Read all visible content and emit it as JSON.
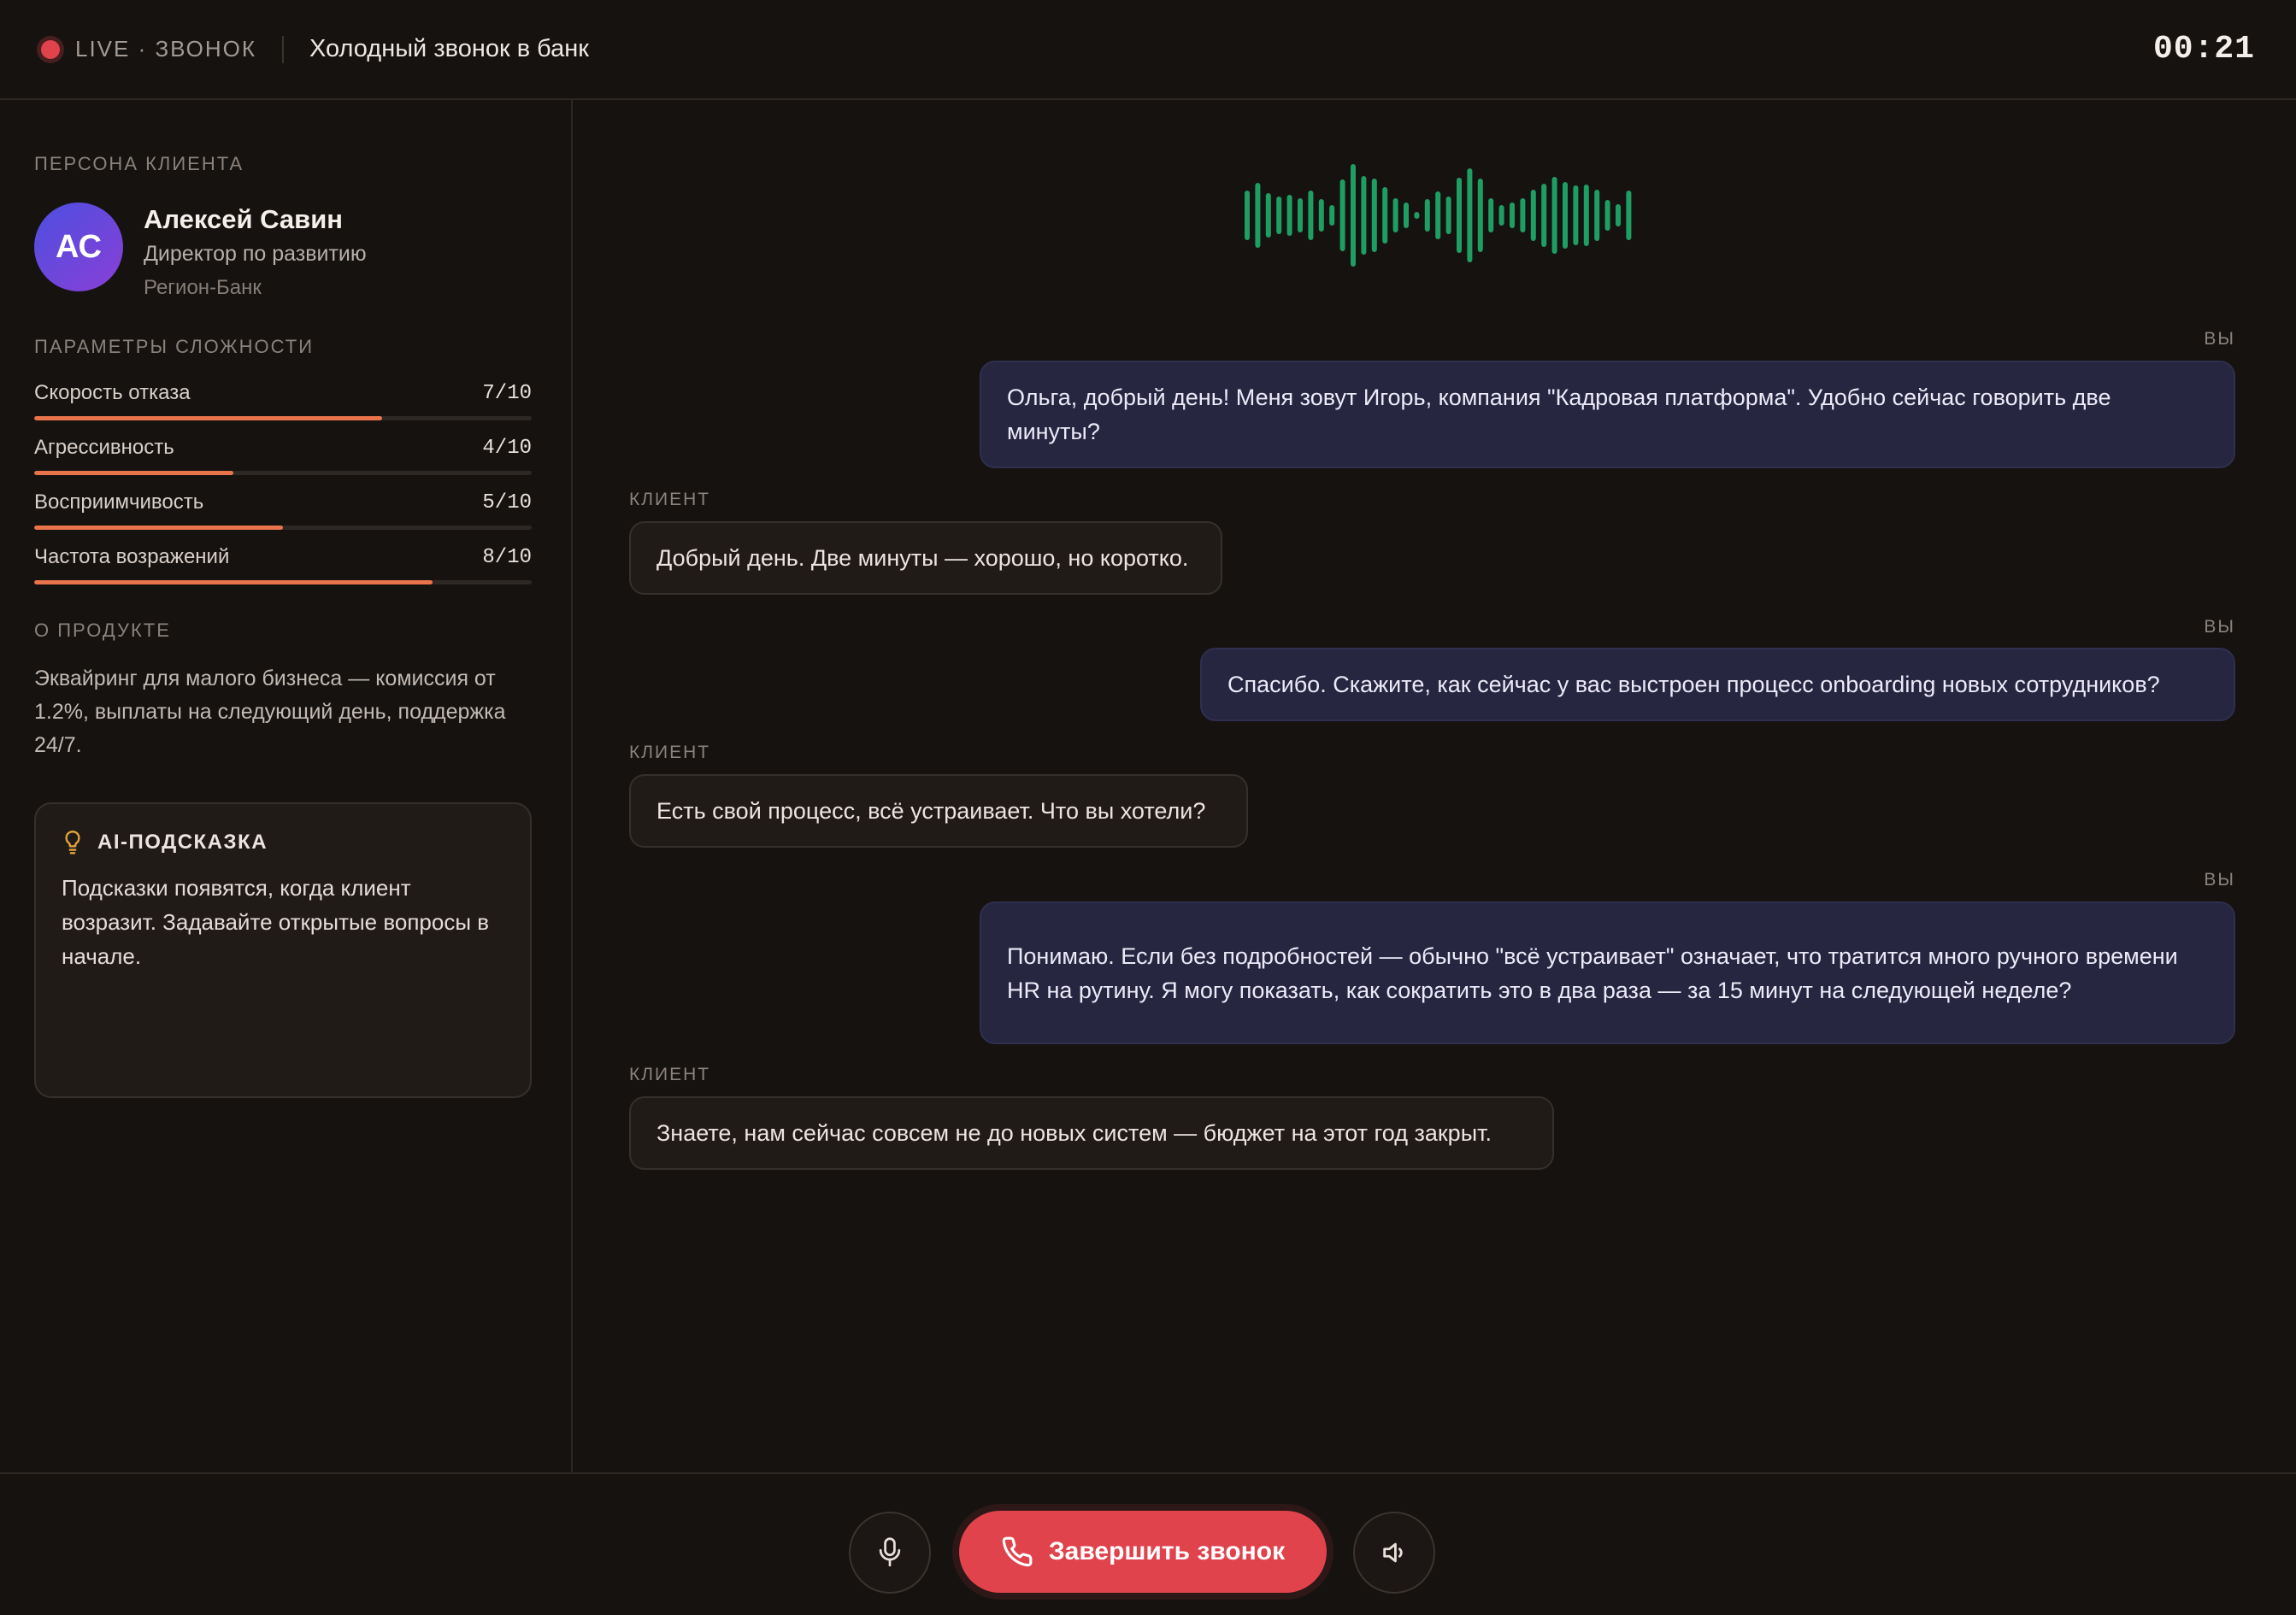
{
  "header": {
    "live_label": "LIVE · ЗВОНОК",
    "title": "Холодный звонок в банк",
    "timer": "00:21"
  },
  "sidebar": {
    "persona_heading": "ПЕРСОНА КЛИЕНТА",
    "persona": {
      "initials": "АС",
      "name": "Алексей Савин",
      "role": "Директор по развитию",
      "company": "Регион-Банк"
    },
    "params_heading": "ПАРАМЕТРЫ СЛОЖНОСТИ",
    "params": [
      {
        "name": "Скорость отказа",
        "value": "7/10",
        "level": 0.7
      },
      {
        "name": "Агрессивность",
        "value": "4/10",
        "level": 0.4
      },
      {
        "name": "Восприимчивость",
        "value": "5/10",
        "level": 0.5
      },
      {
        "name": "Частота возражений",
        "value": "8/10",
        "level": 0.8
      }
    ],
    "product_heading": "О ПРОДУКТЕ",
    "product_text": "Эквайринг для малого бизнеса — комиссия от 1.2%, выплаты на следующий день, поддержка 24/7.",
    "hint": {
      "title": "AI-ПОДСКАЗКА",
      "text": "Подсказки появятся, когда клиент возразит. Задавайте открытые вопросы в начале."
    }
  },
  "conversation": {
    "you_label": "ВЫ",
    "client_label": "КЛИЕНТ",
    "messages": [
      {
        "speaker": "you",
        "text": "Ольга, добрый день! Меня зовут Игорь, компания \"Кадровая платформа\". Удобно сейчас говорить две минуты?"
      },
      {
        "speaker": "client",
        "text": "Добрый день. Две минуты — хорошо, но коротко."
      },
      {
        "speaker": "you",
        "text": "Спасибо. Скажите, как сейчас у вас выстроен процесс onboarding новых сотрудников?"
      },
      {
        "speaker": "client",
        "text": "Есть свой процесс, всё устраивает. Что вы хотели?"
      },
      {
        "speaker": "you",
        "text": "Понимаю. Если без подробностей — обычно \"всё устраивает\" означает, что тратится много ручного времени HR на рутину. Я могу показать, как сократить это в два раза — за 15 минут на следующей неделе?"
      },
      {
        "speaker": "client",
        "text": "Знаете, нам сейчас совсем не до новых систем — бюджет на этот год закрыт."
      }
    ]
  },
  "controls": {
    "end_call_label": "Завершить звонок"
  },
  "colors": {
    "accent_red": "#e0434c",
    "bar_fill": "#e9734b",
    "waveform": "#1f9e63",
    "you_bubble": "#262641"
  },
  "icons": {
    "live": "live-dot",
    "hint": "lightbulb-icon",
    "mic": "microphone-icon",
    "end_call": "phone-icon",
    "speaker": "speaker-icon"
  }
}
